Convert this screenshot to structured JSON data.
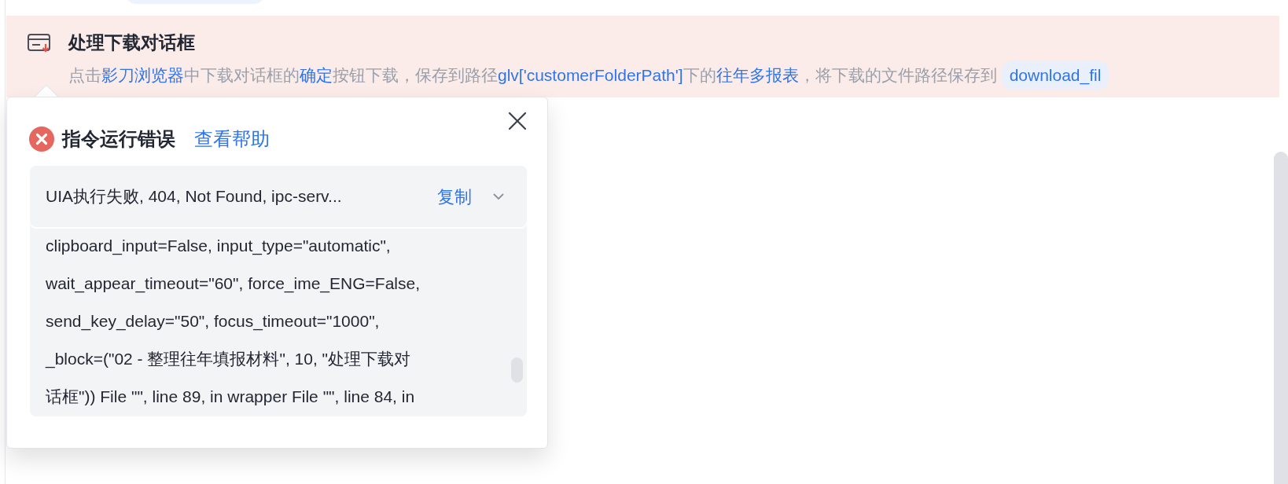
{
  "step": {
    "title": "处理下载对话框",
    "description": [
      {
        "kind": "plain",
        "text": "点击"
      },
      {
        "kind": "highlight",
        "text": "影刀浏览器"
      },
      {
        "kind": "plain",
        "text": "中下载对话框的"
      },
      {
        "kind": "highlight",
        "text": "确定"
      },
      {
        "kind": "plain",
        "text": "按钮下载，保存到路径"
      },
      {
        "kind": "highlight",
        "text": "glv['customerFolderPath']"
      },
      {
        "kind": "plain",
        "text": "下的"
      },
      {
        "kind": "highlight",
        "text": "往年多报表"
      },
      {
        "kind": "plain",
        "text": "，将下载的文件路径保存到"
      }
    ],
    "variable": "download_fil"
  },
  "error_popover": {
    "title": "指令运行错误",
    "help_link": "查看帮助",
    "summary": "UIA执行失败, 404, Not Found, ipc-serv...",
    "copy_button": "复制",
    "log_lines": [
      "clipboard_input=False, input_type=\"automatic\",",
      "wait_appear_timeout=\"60\", force_ime_ENG=False,",
      "send_key_delay=\"50\", focus_timeout=\"1000\",",
      "_block=(\"02 - 整理往年填报材料\", 10, \"处理下载对",
      "话框\")) File \"\", line 89, in wrapper File \"\", line 84, in"
    ]
  }
}
